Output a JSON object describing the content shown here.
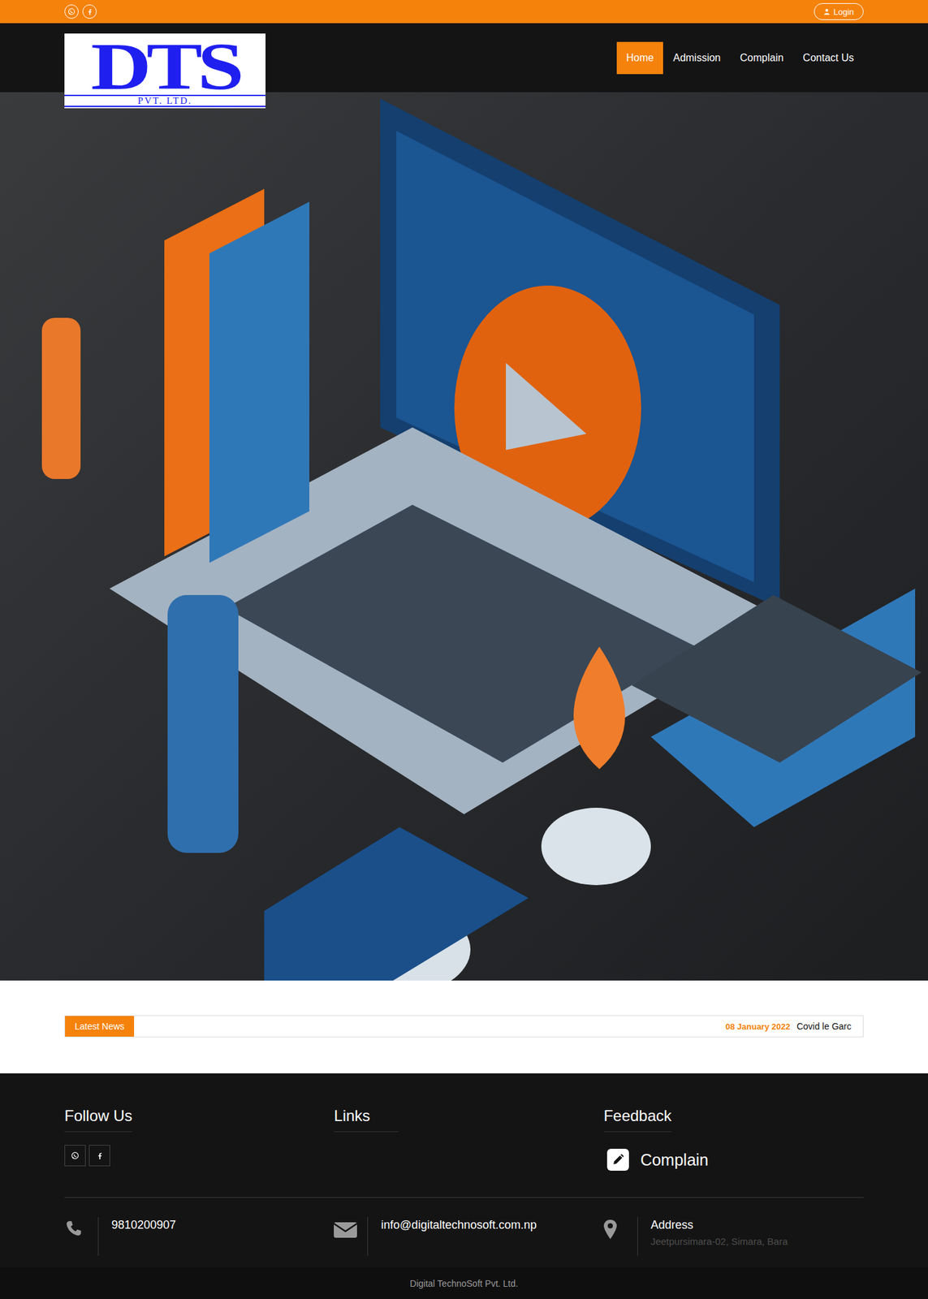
{
  "top_bar": {
    "login": "Login"
  },
  "logo": {
    "letters": "DTS",
    "subtitle": "PVT. LTD."
  },
  "nav": [
    {
      "label": "Home",
      "selected": true
    },
    {
      "label": "Admission",
      "selected": false
    },
    {
      "label": "Complain",
      "selected": false
    },
    {
      "label": "Contact Us",
      "selected": false
    }
  ],
  "news": {
    "label": "Latest News",
    "items": [
      {
        "date": "08 January 2022",
        "text": "Covid le Garc"
      }
    ]
  },
  "footer": {
    "follow_title": "Follow Us",
    "links_title": "Links",
    "feedback_title": "Feedback",
    "feedback_link": "Complain",
    "contacts": [
      {
        "kind": "phone",
        "title": "",
        "text": "9810200907"
      },
      {
        "kind": "email",
        "title": "",
        "text": "info@digitaltechnosoft.com.np"
      },
      {
        "kind": "address",
        "title": "Address",
        "text": "Jeetpursimara-02, Simara, Bara"
      }
    ],
    "copyright": "Digital TechnoSoft Pvt. Ltd."
  }
}
